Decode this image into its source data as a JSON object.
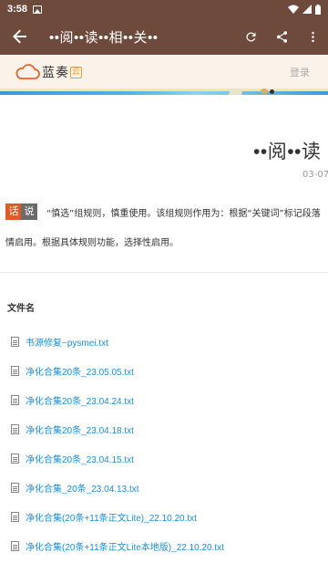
{
  "status_bar": {
    "time": "3:58",
    "icons": [
      "image-icon",
      "wifi-icon",
      "signal-icon",
      "battery-icon"
    ]
  },
  "app_bar": {
    "title": "••阅••读••相••关••",
    "actions": [
      "refresh-icon",
      "share-icon",
      "more-vert-icon"
    ],
    "background": "#6e4a3c"
  },
  "site_header": {
    "logo_text": "蓝奏",
    "logo_badge": "云",
    "login_label": "登录"
  },
  "document": {
    "title": "••阅••读",
    "date": "03-07",
    "tag_1": "话",
    "tag_2": "说",
    "description_line1": "“慎选”组规则，慎重使用。该组规则作用为：根据“关键词”标记段落",
    "description_line2": "情启用。根据具体规则功能，选择性启用。"
  },
  "files": {
    "header": "文件名",
    "items": [
      "书源修复~pysmei.txt",
      "净化合集20条_23.05.05.txt",
      "净化合集20条_23.04.24.txt",
      "净化合集20条_23.04.18.txt",
      "净化合集20条_23.04.15.txt",
      "净化合集_20条_23.04.13.txt",
      "净化合集(20条+11条正文Lite)_22.10.20.txt",
      "净化合集(20条+11条正文Lite本地版)_22.10.20.txt"
    ],
    "link_color": "#1a8fd8"
  }
}
